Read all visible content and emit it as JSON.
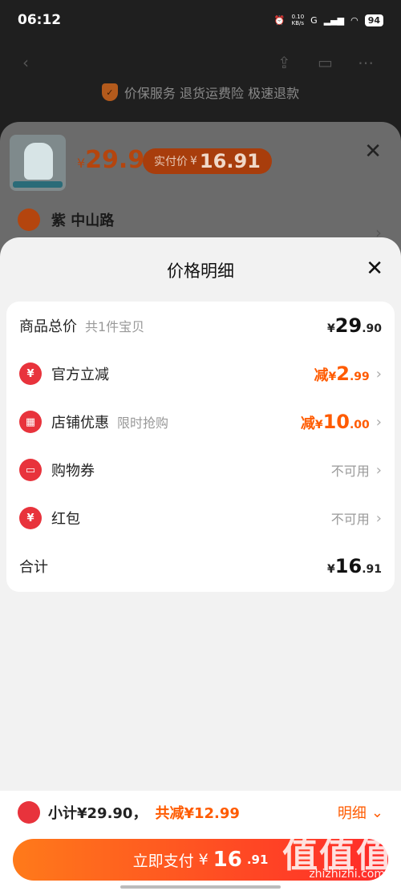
{
  "status": {
    "time": "06:12",
    "net_speed": "0.10",
    "net_unit": "KB/s",
    "net_type": "G",
    "battery": "94"
  },
  "service_bar": {
    "text": "价保服务 退货运费险 极速退款"
  },
  "order": {
    "price_symbol": "¥",
    "price": "29.9",
    "real_pay_label": "实付价",
    "real_pay_symbol": "¥",
    "real_pay_value": "16.91",
    "address": "紫 中山路"
  },
  "detail": {
    "title": "价格明细",
    "rows": [
      {
        "label": "商品总价",
        "sub": "共1件宝贝",
        "prefix": "",
        "symbol": "¥",
        "int": "29",
        "dec": ".90",
        "icon": ""
      },
      {
        "label": "官方立减",
        "sub": "",
        "prefix": "减",
        "symbol": "¥",
        "int": "2",
        "dec": ".99",
        "icon": "yuan-circle-icon"
      },
      {
        "label": "店铺优惠",
        "sub": "限时抢购",
        "prefix": "减",
        "symbol": "¥",
        "int": "10",
        "dec": ".00",
        "icon": "shop-icon"
      },
      {
        "label": "购物券",
        "sub": "",
        "status": "不可用",
        "icon": "coupon-icon"
      },
      {
        "label": "红包",
        "sub": "",
        "status": "不可用",
        "icon": "red-packet-icon"
      },
      {
        "label": "合计",
        "sub": "",
        "symbol": "¥",
        "int": "16",
        "dec": ".91"
      }
    ]
  },
  "bottom": {
    "subtotal": "小计¥29.90，",
    "total_cut": "共减¥12.99",
    "detail_label": "明细",
    "pay_label": "立即支付",
    "pay_symbol": "¥",
    "pay_int": "16",
    "pay_dec": ".91"
  },
  "watermark": {
    "main": "值值值",
    "sub": "zhizhizhi.com"
  },
  "colors": {
    "accent": "#ff5b00",
    "icon_red": "#e8333c",
    "pay_gradient_start": "#ff7a1a",
    "pay_gradient_end": "#ff2a2a"
  }
}
